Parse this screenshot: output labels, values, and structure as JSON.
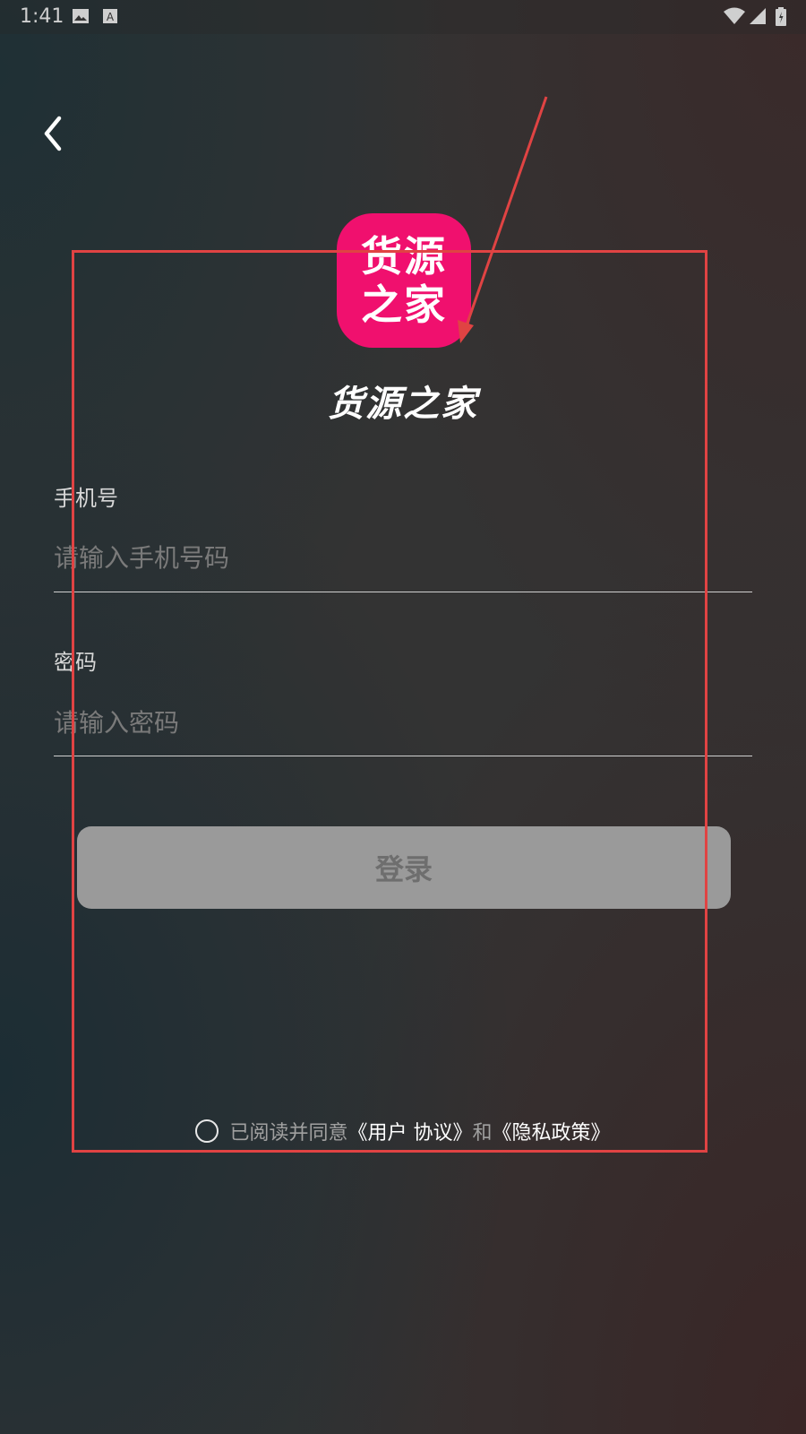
{
  "status_bar": {
    "time": "1:41",
    "icons": [
      "image-icon",
      "font-icon",
      "wifi-icon",
      "signal-icon",
      "battery-icon"
    ]
  },
  "header": {
    "back_icon": "chevron-left-icon"
  },
  "logo": {
    "line1": "货源",
    "line2": "之家",
    "background_color": "#f0106e"
  },
  "app_name": "货源之家",
  "form": {
    "phone": {
      "label": "手机号",
      "placeholder": "请输入手机号码",
      "value": ""
    },
    "password": {
      "label": "密码",
      "placeholder": "请输入密码",
      "value": ""
    },
    "login_label": "登录"
  },
  "agreement": {
    "checked": false,
    "prefix": "已阅读并同意",
    "user_agreement": "《用户 协议》",
    "conjunction": "和",
    "privacy_policy": "《隐私政策》"
  },
  "annotation": {
    "color": "#e04343"
  }
}
